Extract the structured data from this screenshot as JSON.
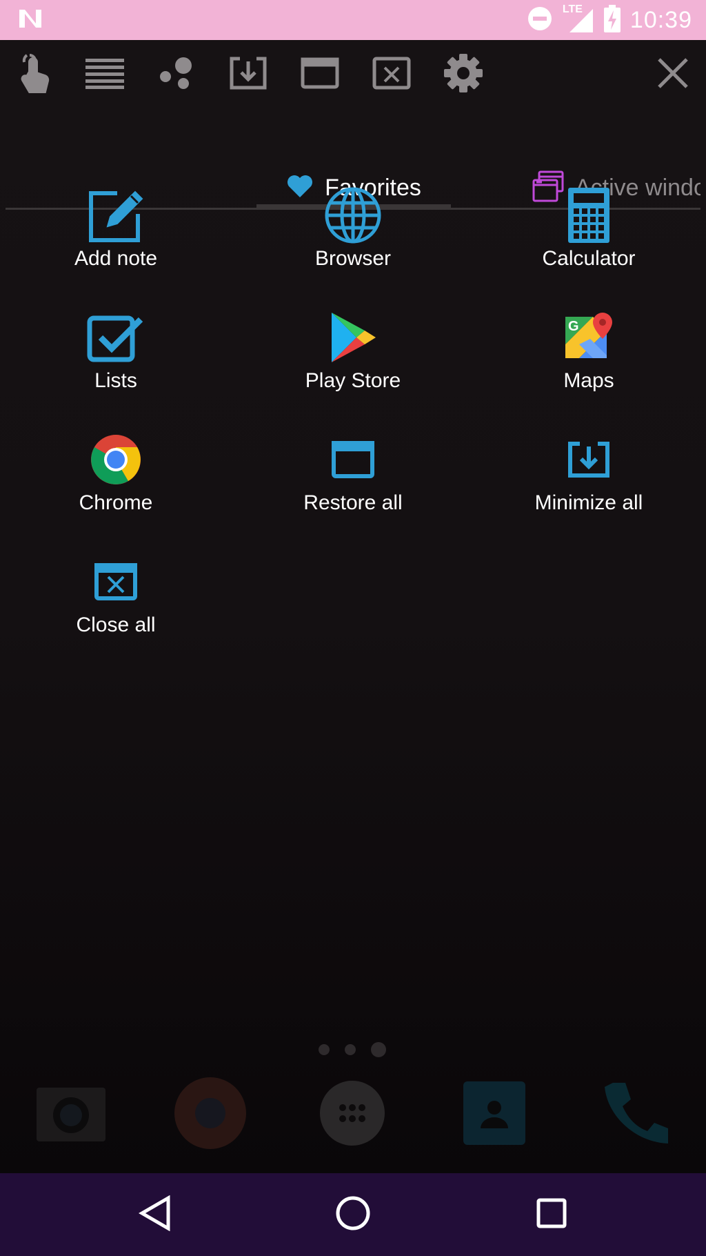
{
  "status": {
    "time": "10:39",
    "network": "LTE"
  },
  "toolbar": {
    "icons": [
      "touch-icon",
      "lines-icon",
      "bubbles-icon",
      "minimize-icon",
      "window-icon",
      "close-window-icon",
      "gear-icon",
      "close-icon"
    ]
  },
  "tabs": [
    {
      "label": "Favorites",
      "icon": "heart-icon",
      "color": "#2f9fd6",
      "active": true
    },
    {
      "label": "Active windows",
      "icon": "windows-icon",
      "color": "#c049d9",
      "active": false
    }
  ],
  "favorites": [
    {
      "label": "Add note",
      "icon": "edit-note-icon"
    },
    {
      "label": "Browser",
      "icon": "globe-icon"
    },
    {
      "label": "Calculator",
      "icon": "calculator-icon"
    },
    {
      "label": "Lists",
      "icon": "checkbox-icon"
    },
    {
      "label": "Play Store",
      "icon": "play-store-icon"
    },
    {
      "label": "Maps",
      "icon": "maps-icon"
    },
    {
      "label": "Chrome",
      "icon": "chrome-icon"
    },
    {
      "label": "Restore all",
      "icon": "restore-window-icon"
    },
    {
      "label": "Minimize all",
      "icon": "minimize-window-icon"
    },
    {
      "label": "Close all",
      "icon": "close-window-icon"
    }
  ],
  "colors": {
    "accent": "#2f9fd6",
    "status_bar": "#f2b3d6",
    "nav_bar": "#220d38",
    "toolbar_icon": "#8f8b8d"
  }
}
